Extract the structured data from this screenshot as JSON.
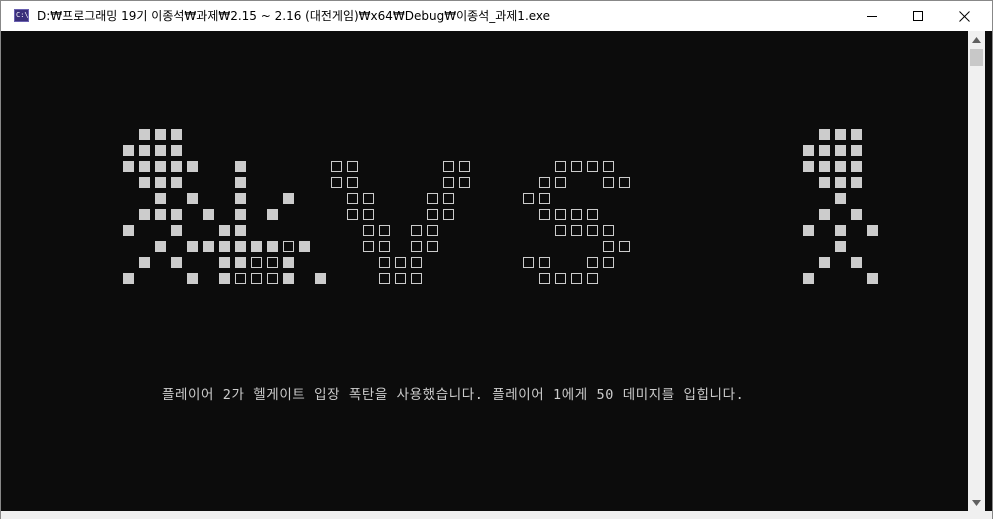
{
  "window": {
    "title": "D:₩프로그래밍 19기 이종석₩과제₩2.15 ~ 2.16 (대전게임)₩x64₩Debug₩이종석_과제1.exe",
    "icon_label": "C:\\",
    "icon": "console-app-icon",
    "controls": [
      "minimize-icon",
      "maximize-icon",
      "close-icon"
    ]
  },
  "console": {
    "background_color": "#0c0c0c",
    "text_color": "#cccccc",
    "message": "플레이어 2가 헬게이트 입장 폭탄을 사용했습니다. 플레이어 1에게 50 데미지를 입힙니다."
  },
  "scrollbar": {
    "up_icon": "scroll-up-arrow-icon",
    "down_icon": "scroll-down-arrow-icon"
  }
}
